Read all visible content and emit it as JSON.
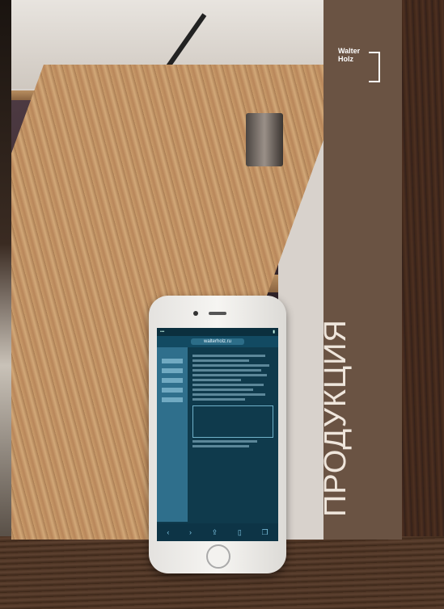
{
  "booklet": {
    "brand_line1": "Walter",
    "brand_line2": "Holz",
    "title": "ПРОДУКЦИЯ"
  },
  "phone": {
    "url": "walterholz.ru",
    "toolbar_icons": [
      "back-icon",
      "forward-icon",
      "share-icon",
      "bookmarks-icon",
      "tabs-icon"
    ]
  },
  "colors": {
    "band": "#6a5343",
    "title_text": "#efe6dc",
    "screen": "#0f3a4c"
  }
}
